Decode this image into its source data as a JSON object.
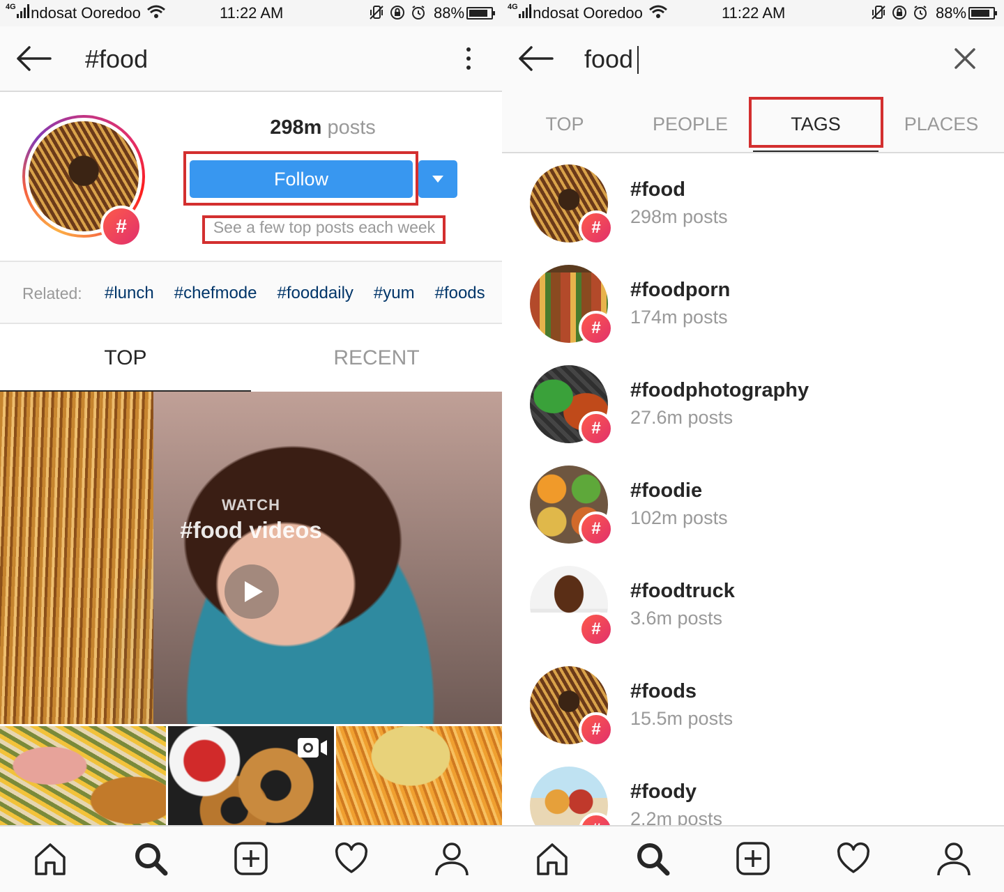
{
  "status_bar": {
    "network": "4G",
    "carrier": "Indosat Ooredoo",
    "time": "11:22 AM",
    "battery_pct": "88%",
    "battery_level": 0.88
  },
  "left": {
    "header": {
      "title": "#food"
    },
    "profile": {
      "posts_num": "298m",
      "posts_label": "posts",
      "follow_label": "Follow",
      "follow_hint": "See a few top posts each week",
      "badge": "#"
    },
    "related": {
      "label": "Related:",
      "tags": [
        "#lunch",
        "#chefmode",
        "#fooddaily",
        "#yum",
        "#foods"
      ]
    },
    "tabs": [
      {
        "label": "TOP",
        "active": true
      },
      {
        "label": "RECENT",
        "active": false
      }
    ],
    "video": {
      "watch": "WATCH",
      "title": "#food videos"
    }
  },
  "right": {
    "search": {
      "value": "food"
    },
    "tabs": [
      {
        "label": "TOP",
        "active": false
      },
      {
        "label": "PEOPLE",
        "active": false
      },
      {
        "label": "TAGS",
        "active": true
      },
      {
        "label": "PLACES",
        "active": false
      }
    ],
    "results": [
      {
        "name": "#food",
        "count": "298m posts"
      },
      {
        "name": "#foodporn",
        "count": "174m posts"
      },
      {
        "name": "#foodphotography",
        "count": "27.6m posts"
      },
      {
        "name": "#foodie",
        "count": "102m posts"
      },
      {
        "name": "#foodtruck",
        "count": "3.6m posts"
      },
      {
        "name": "#foods",
        "count": "15.5m posts"
      },
      {
        "name": "#foody",
        "count": "2.2m posts"
      }
    ]
  },
  "bottom_nav": [
    "home-icon",
    "search-icon",
    "add-post-icon",
    "heart-icon",
    "profile-icon"
  ],
  "colors": {
    "accent_blue": "#3897f0",
    "highlight_red": "#d32f2f",
    "link_navy": "#003569",
    "muted_grey": "#999999"
  }
}
